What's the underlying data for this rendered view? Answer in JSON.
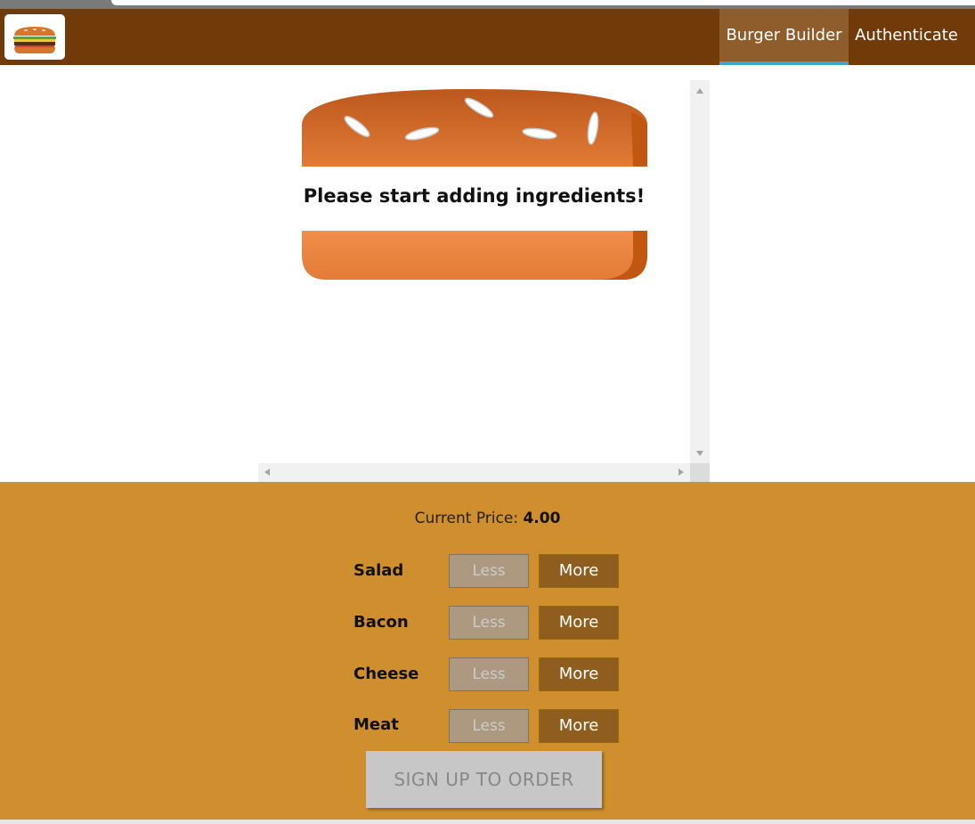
{
  "nav": {
    "items": [
      {
        "label": "Burger Builder",
        "active": true
      },
      {
        "label": "Authenticate",
        "active": false
      }
    ]
  },
  "preview": {
    "empty_message": "Please start adding ingredients!"
  },
  "controls": {
    "price_label": "Current Price:",
    "price_value": "4.00",
    "ingredients": [
      {
        "label": "Salad",
        "less": "Less",
        "more": "More"
      },
      {
        "label": "Bacon",
        "less": "Less",
        "more": "More"
      },
      {
        "label": "Cheese",
        "less": "Less",
        "more": "More"
      },
      {
        "label": "Meat",
        "less": "Less",
        "more": "More"
      }
    ],
    "order_button": "SIGN UP TO ORDER"
  },
  "icons": {
    "logo": "burger-logo-icon"
  },
  "colors": {
    "toolbar": "#703b09",
    "nav_active": "#8f5c2c",
    "nav_underline": "#40a4c8",
    "controls_bg": "#cf8f2e",
    "more_button": "#8f5e1e",
    "less_button": "#ac9980",
    "order_button_disabled": "#c7c7c7"
  }
}
